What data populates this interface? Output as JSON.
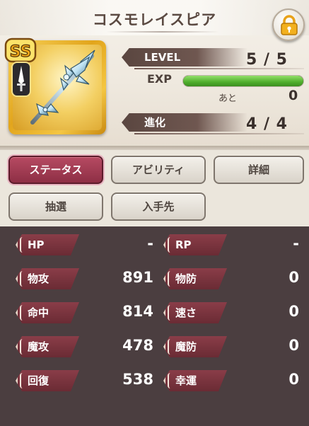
{
  "item": {
    "name": "コスモレイスピア",
    "rank": "SS"
  },
  "progress": {
    "level_label": "LEVEL",
    "level_value": "5 / 5",
    "exp_label": "EXP",
    "exp_fill_fraction": 1.0,
    "remain_label": "あと",
    "remain_value": "0",
    "evolution_label": "進化",
    "evolution_value": "4 / 4"
  },
  "tabs": [
    {
      "label": "ステータス",
      "active": true
    },
    {
      "label": "アビリティ",
      "active": false
    },
    {
      "label": "詳細",
      "active": false
    },
    {
      "label": "抽選",
      "active": false
    },
    {
      "label": "入手先",
      "active": false
    }
  ],
  "stats": [
    {
      "left_label": "HP",
      "left_value": "-",
      "right_label": "RP",
      "right_value": "-"
    },
    {
      "left_label": "物攻",
      "left_value": "891",
      "right_label": "物防",
      "right_value": "0"
    },
    {
      "left_label": "命中",
      "left_value": "814",
      "right_label": "速さ",
      "right_value": "0"
    },
    {
      "left_label": "魔攻",
      "left_value": "478",
      "right_label": "魔防",
      "right_value": "0"
    },
    {
      "left_label": "回復",
      "left_value": "538",
      "right_label": "幸運",
      "right_value": "0"
    }
  ],
  "colors": {
    "accent": "#9b3a52",
    "exp_bar": "#4fae2c",
    "stat_panel": "#4b3e40",
    "stat_label": "#7a3440",
    "gold_frame": "#e2a51c"
  },
  "icons": {
    "lock": "lock-icon",
    "rank_badge": "ss-rank-badge-icon",
    "weapon": "spear-weapon-icon",
    "type": "sword-type-icon"
  }
}
